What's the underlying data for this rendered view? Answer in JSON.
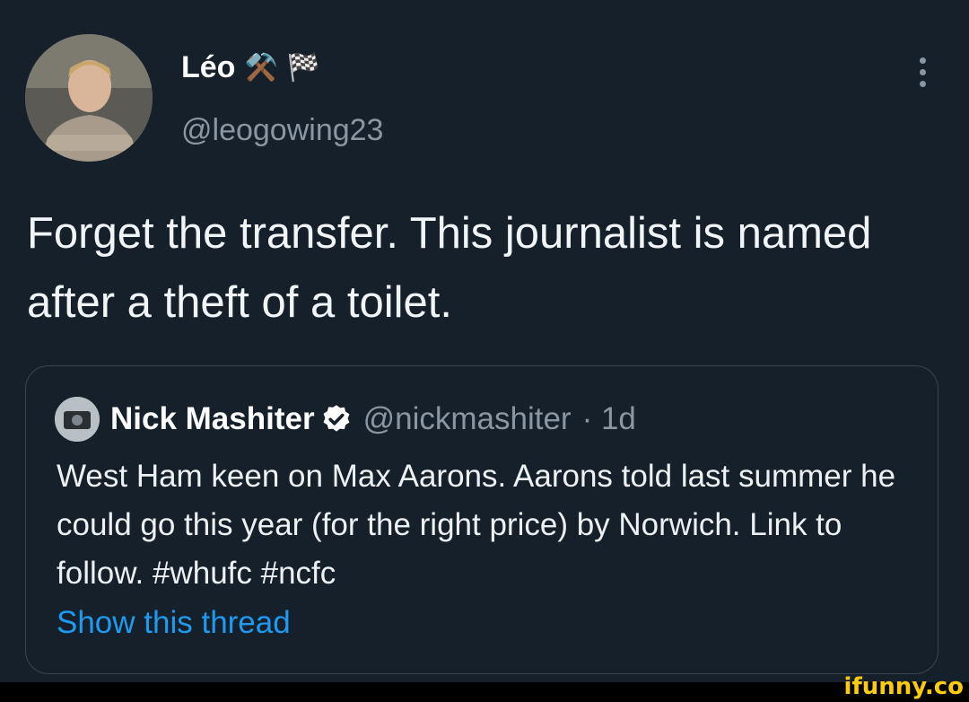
{
  "author": {
    "name": "Léo",
    "emoji": [
      "⚒️",
      "🏁"
    ],
    "handle": "@leogowing23"
  },
  "tweet": {
    "text": "Forget the transfer. This journalist is named after a theft of a toilet."
  },
  "quoted_tweet": {
    "name": "Nick Mashiter",
    "handle": "@nickmashiter",
    "time": "· 1d",
    "text": "West Ham keen on Max Aarons. Aarons told last summer he could go this year (for the right price) by Norwich. Link to follow. #whufc #ncfc",
    "link": "Show this thread"
  },
  "watermark": "ifunny.co",
  "colors": {
    "background": "#16202b",
    "link": "#1d9bf0",
    "secondary_text": "#8a97a3",
    "watermark": "#ffcc00"
  }
}
